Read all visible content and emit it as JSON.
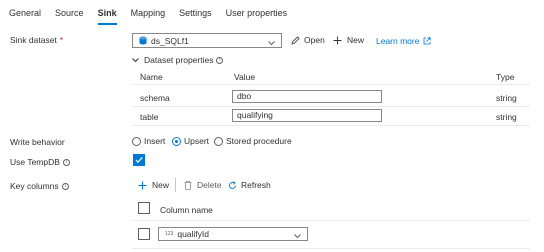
{
  "tabs": [
    {
      "label": "General"
    },
    {
      "label": "Source"
    },
    {
      "label": "Sink",
      "active": true
    },
    {
      "label": "Mapping"
    },
    {
      "label": "Settings"
    },
    {
      "label": "User properties"
    }
  ],
  "sink_dataset": {
    "label": "Sink dataset",
    "required_mark": "*",
    "value": "ds_SQLf1",
    "open_label": "Open",
    "new_label": "New",
    "learn_more_label": "Learn more"
  },
  "dataset_properties": {
    "title": "Dataset properties",
    "columns": {
      "name": "Name",
      "value": "Value",
      "type": "Type"
    },
    "rows": [
      {
        "name": "schema",
        "value": "dbo",
        "type": "string"
      },
      {
        "name": "table",
        "value": "qualifying",
        "type": "string"
      }
    ]
  },
  "write_behavior": {
    "label": "Write behavior",
    "options": [
      {
        "label": "Insert",
        "selected": false
      },
      {
        "label": "Upsert",
        "selected": true
      },
      {
        "label": "Stored procedure",
        "selected": false
      }
    ]
  },
  "use_tempdb": {
    "label": "Use TempDB",
    "checked": true
  },
  "key_columns": {
    "label": "Key columns",
    "toolbar": {
      "new_label": "New",
      "delete_label": "Delete",
      "refresh_label": "Refresh"
    },
    "header": "Column name",
    "rows": [
      {
        "type_badge": "123",
        "value": "qualifyId"
      }
    ]
  },
  "colors": {
    "accent": "#0078d4",
    "text": "#323130",
    "required": "#a4262c"
  }
}
